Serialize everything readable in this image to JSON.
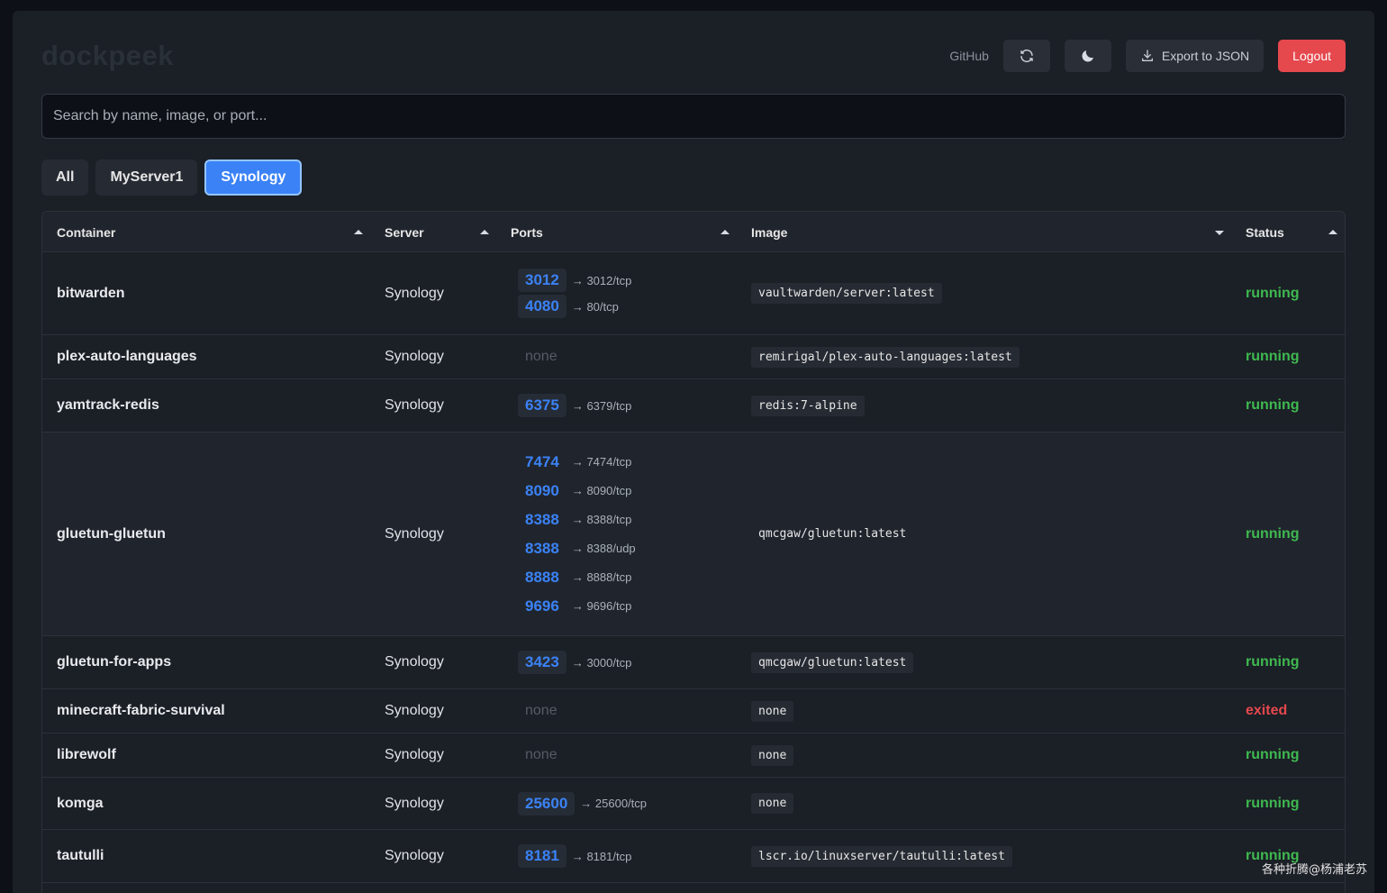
{
  "header": {
    "brand": "dockpeek",
    "github_label": "GitHub",
    "export_label": "Export to JSON",
    "logout_label": "Logout"
  },
  "search": {
    "placeholder": "Search by name, image, or port..."
  },
  "tabs": [
    {
      "label": "All",
      "active": false
    },
    {
      "label": "MyServer1",
      "active": false
    },
    {
      "label": "Synology",
      "active": true
    }
  ],
  "table": {
    "columns": {
      "container": "Container",
      "server": "Server",
      "ports": "Ports",
      "image": "Image",
      "status": "Status"
    },
    "none_label": "none",
    "rows": [
      {
        "name": "bitwarden",
        "server": "Synology",
        "ports": [
          {
            "host": "3012",
            "map": "→ 3012/tcp"
          },
          {
            "host": "4080",
            "map": "→ 80/tcp"
          }
        ],
        "image": "vaultwarden/server:latest",
        "status": "running"
      },
      {
        "name": "plex-auto-languages",
        "server": "Synology",
        "ports": [],
        "image": "remirigal/plex-auto-languages:latest",
        "status": "running"
      },
      {
        "name": "yamtrack-redis",
        "server": "Synology",
        "ports": [
          {
            "host": "6375",
            "map": "→ 6379/tcp"
          }
        ],
        "image": "redis:7-alpine",
        "status": "running"
      },
      {
        "name": "gluetun-gluetun",
        "server": "Synology",
        "ports": [
          {
            "host": "7474",
            "map": "→ 7474/tcp"
          },
          {
            "host": "8090",
            "map": "→ 8090/tcp"
          },
          {
            "host": "8388",
            "map": "→ 8388/tcp"
          },
          {
            "host": "8388",
            "map": "→ 8388/udp"
          },
          {
            "host": "8888",
            "map": "→ 8888/tcp"
          },
          {
            "host": "9696",
            "map": "→ 9696/tcp"
          }
        ],
        "image": "qmcgaw/gluetun:latest",
        "status": "running"
      },
      {
        "name": "gluetun-for-apps",
        "server": "Synology",
        "ports": [
          {
            "host": "3423",
            "map": "→ 3000/tcp"
          }
        ],
        "image": "qmcgaw/gluetun:latest",
        "status": "running"
      },
      {
        "name": "minecraft-fabric-survival",
        "server": "Synology",
        "ports": [],
        "image": "none",
        "status": "exited"
      },
      {
        "name": "librewolf",
        "server": "Synology",
        "ports": [],
        "image": "none",
        "status": "running"
      },
      {
        "name": "komga",
        "server": "Synology",
        "ports": [
          {
            "host": "25600",
            "map": "→ 25600/tcp"
          }
        ],
        "image": "none",
        "status": "running"
      },
      {
        "name": "tautulli",
        "server": "Synology",
        "ports": [
          {
            "host": "8181",
            "map": "→ 8181/tcp"
          }
        ],
        "image": "lscr.io/linuxserver/tautulli:latest",
        "status": "running"
      }
    ]
  },
  "watermark": "各种折腾@杨浦老苏",
  "colors": {
    "accent": "#3b82f6",
    "running": "#3fb950",
    "exited": "#e5484d",
    "logout": "#e5484d"
  }
}
